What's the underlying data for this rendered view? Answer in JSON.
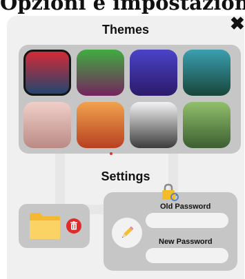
{
  "window": {
    "heading": "Opzioni e impostazioni (p"
  },
  "themes": {
    "title": "Themes",
    "swatches": [
      {
        "name": "red-navy",
        "colors": [
          "#d42a36",
          "#22466e"
        ],
        "selected": true
      },
      {
        "name": "green-magenta",
        "colors": [
          "#40ac40",
          "#75245e"
        ],
        "selected": false
      },
      {
        "name": "indigo",
        "colors": [
          "#4a43c8",
          "#2c1a6a"
        ],
        "selected": false
      },
      {
        "name": "teal",
        "colors": [
          "#3a9fb0",
          "#18463a"
        ],
        "selected": false
      },
      {
        "name": "rose",
        "colors": [
          "#f0cfc9",
          "#ba8a86"
        ],
        "selected": false
      },
      {
        "name": "orange",
        "colors": [
          "#f0a24e",
          "#b84020"
        ],
        "selected": false
      },
      {
        "name": "gray",
        "colors": [
          "#f2f2f4",
          "#3c3c3c"
        ],
        "selected": false
      },
      {
        "name": "olive",
        "colors": [
          "#90bf6a",
          "#3d5e32"
        ],
        "selected": false
      }
    ],
    "page_indicator_color": "#e03030"
  },
  "settings": {
    "title": "Settings",
    "old_password_label": "Old Password",
    "new_password_label": "New Password",
    "old_password_value": "",
    "new_password_value": ""
  },
  "icons": {
    "close": "close-icon",
    "folder": "folder-icon",
    "trash": "trash-icon",
    "lock": "lock-refresh-icon",
    "edit": "pencil-icon"
  },
  "colors": {
    "panel_bg": "#f0f0f0",
    "box_bg": "#c6c6c6",
    "folder": "#f7c74a",
    "delete_red": "#e02b2b"
  }
}
